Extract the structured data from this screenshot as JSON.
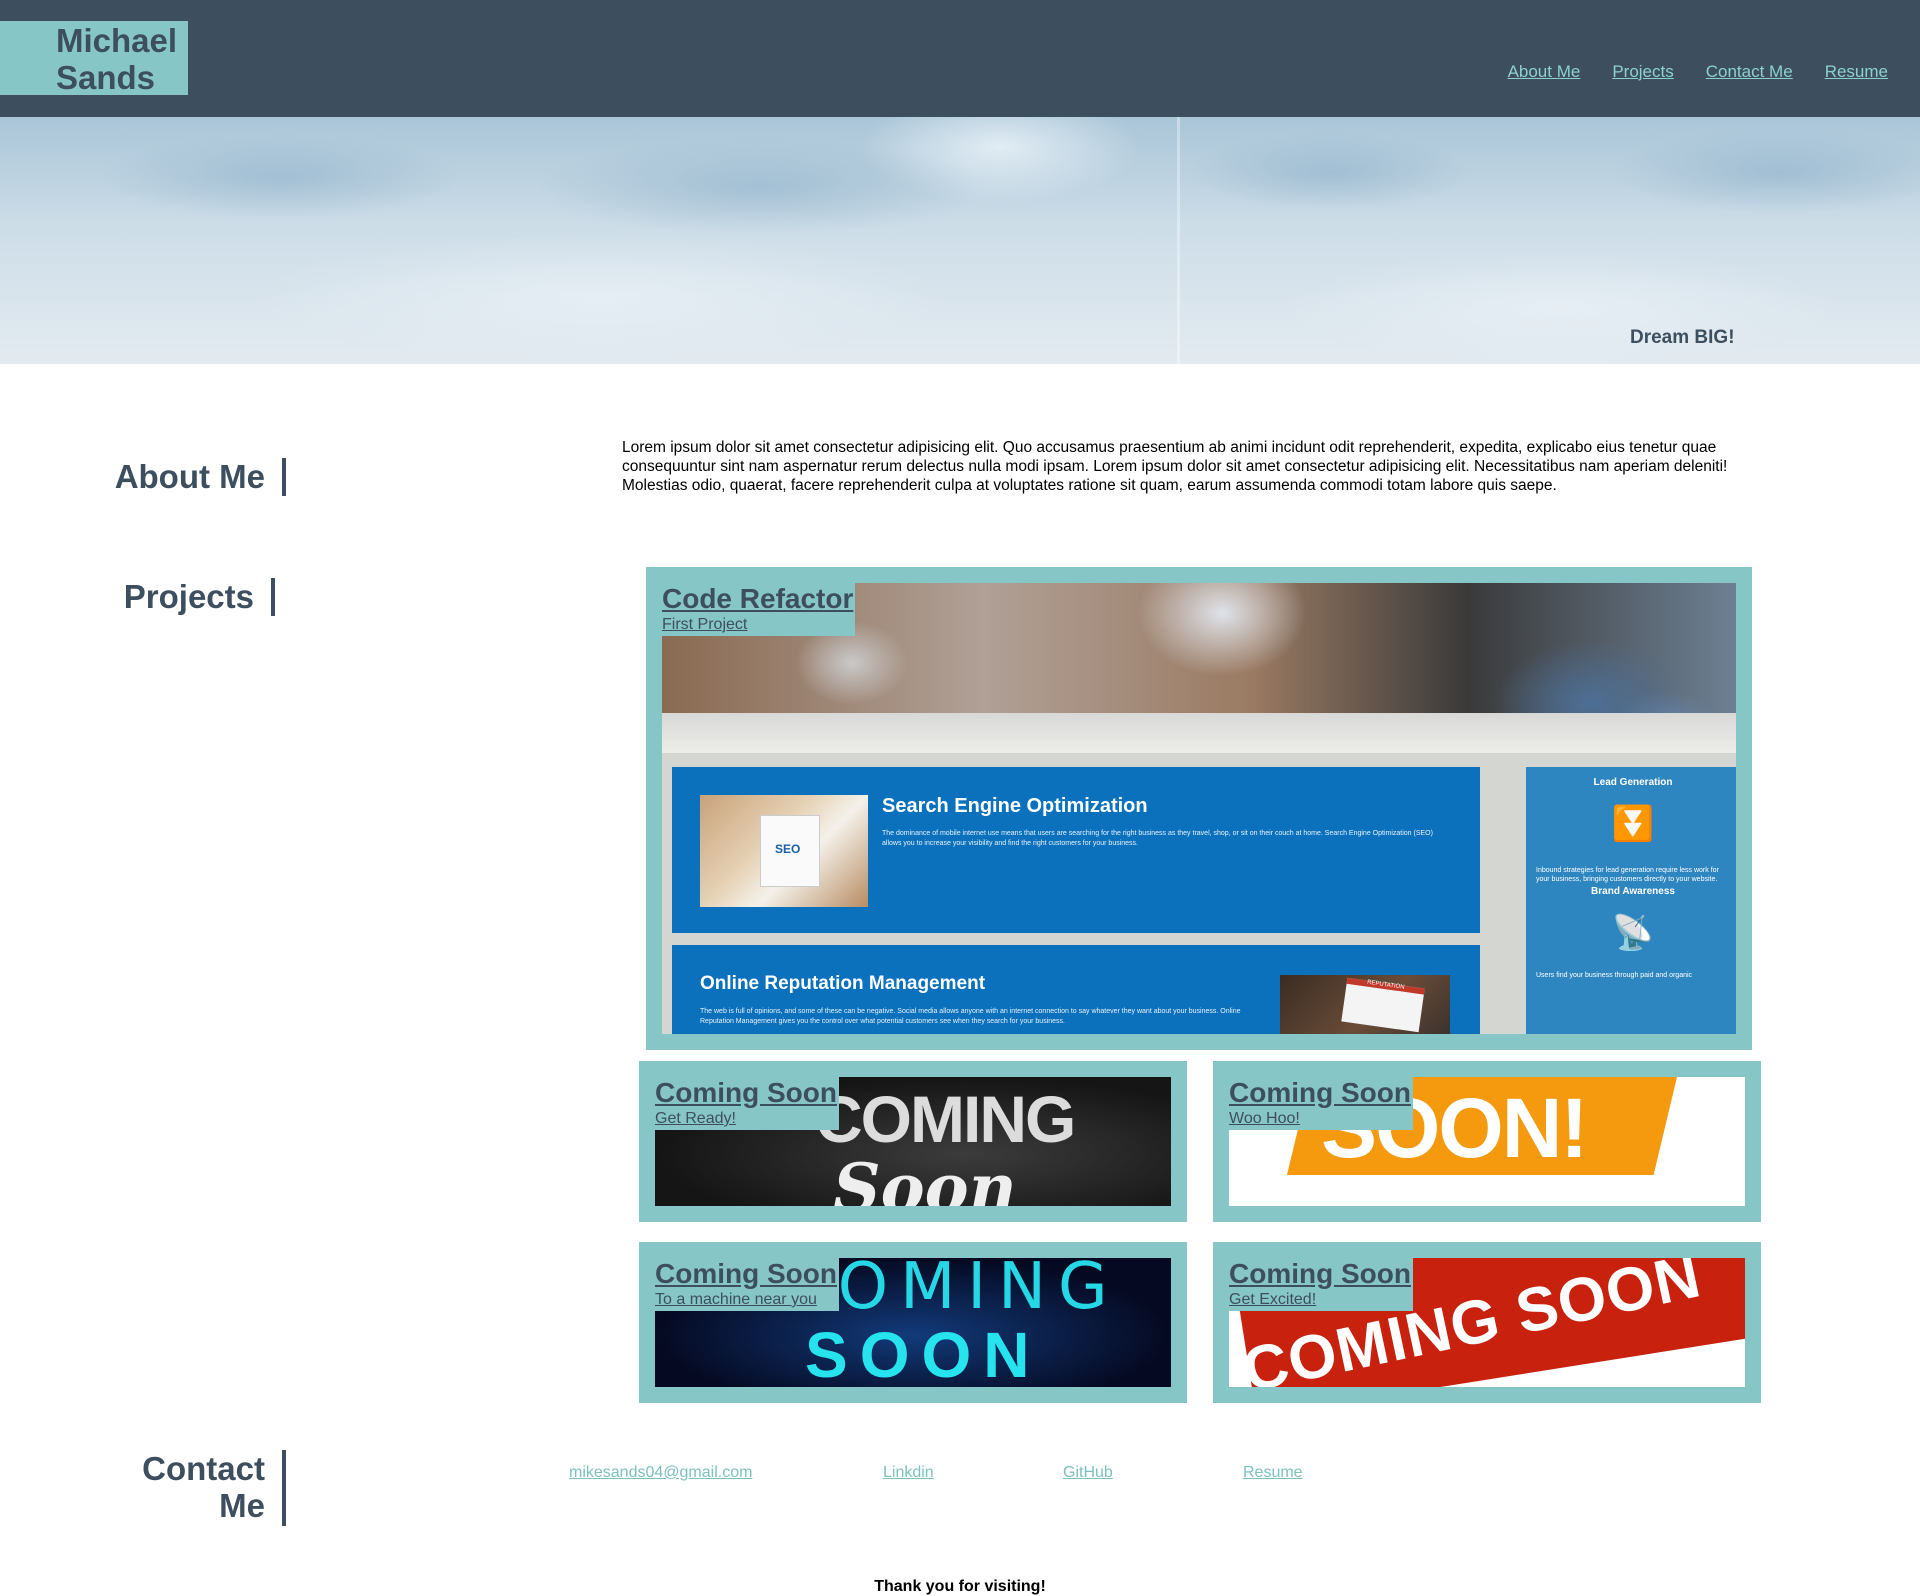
{
  "header": {
    "brand_line1": "Michael",
    "brand_line2": "Sands",
    "nav": [
      "About Me",
      "Projects",
      "Contact Me",
      "Resume"
    ]
  },
  "hero": {
    "tagline": "Dream BIG!"
  },
  "about": {
    "heading": "About Me",
    "text": "Lorem ipsum dolor sit amet consectetur adipisicing elit. Quo accusamus praesentium ab animi incidunt odit reprehenderit, expedita, explicabo eius tenetur quae consequuntur sint nam aspernatur rerum delectus nulla modi ipsam. Lorem ipsum dolor sit amet consectetur adipisicing elit. Necessitatibus nam aperiam deleniti! Molestias odio, quaerat, facere reprehenderit culpa at voluptates ratione sit quam, earum assumenda commodi totam labore quis saepe."
  },
  "projects": {
    "heading": "Projects",
    "main": {
      "title": "Code Refactor",
      "subtitle": "First Project",
      "preview": {
        "seo_title": "Search Engine Optimization",
        "seo_text": "The dominance of mobile internet use means that users are searching for the right business as they travel, shop, or sit on their couch at home. Search Engine Optimization (SEO) allows you to increase your visibility and find the right customers for your business.",
        "seo_badge": "SEO",
        "orm_title": "Online Reputation Management",
        "orm_text": "The web is full of opinions, and some of these can be negative. Social media allows anyone with an internet connection to say whatever they want about your business. Online Reputation Management gives you the control over what potential customers see when they search for your business.",
        "orm_badge": "REPUTATION",
        "lead_title": "Lead Generation",
        "lead_text": "Inbound strategies for lead generation require less work for your business, bringing customers directly to your website.",
        "brand_title": "Brand Awareness",
        "users_text": "Users find your business through paid and organic"
      }
    },
    "cards": [
      {
        "title": "Coming Soon",
        "subtitle": "Get Ready!",
        "image_text": [
          "COMING",
          "Soon"
        ]
      },
      {
        "title": "Coming Soon",
        "subtitle": "Woo Hoo!",
        "image_text": [
          "SOON!"
        ]
      },
      {
        "title": "Coming Soon",
        "subtitle": "To a machine near you",
        "image_text": [
          "COMING",
          "SOON"
        ]
      },
      {
        "title": "Coming Soon",
        "subtitle": "Get Excited!",
        "image_text": [
          "COMING SOON"
        ]
      }
    ]
  },
  "contact": {
    "heading_line1": "Contact",
    "heading_line2": "Me",
    "links": [
      "mikesands04@gmail.com",
      "Linkdin",
      "GitHub",
      "Resume"
    ]
  },
  "footer": {
    "text": "Thank you for visiting!"
  },
  "colors": {
    "header_bg": "#3d4f5f",
    "accent": "#86c6c6",
    "link": "#7cc0c0",
    "seo_blue": "#0b71bd"
  }
}
